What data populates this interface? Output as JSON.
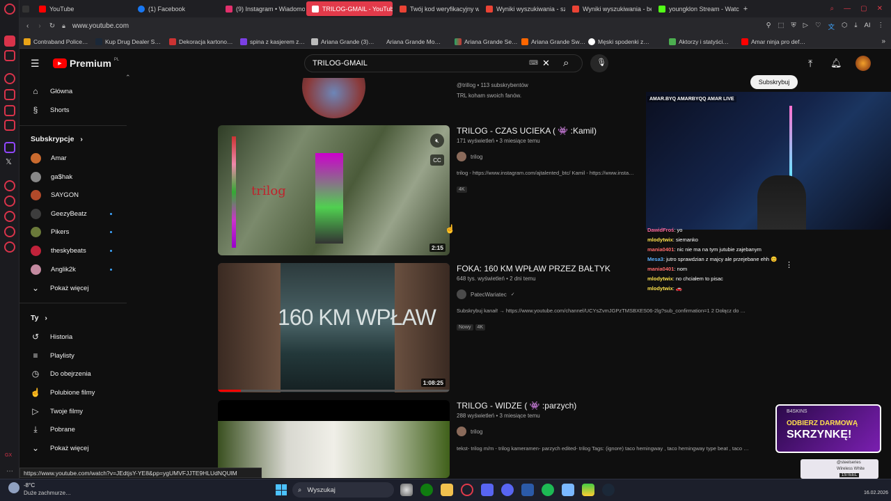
{
  "browser": {
    "tabs": [
      {
        "label": "YouTube",
        "color": "#ff0000"
      },
      {
        "label": "(1) Facebook",
        "color": "#1877f2"
      },
      {
        "label": "(9) Instagram • Wiadomo…",
        "color": "#e1306c"
      },
      {
        "label": "TRILOG-GMAIL - YouTube",
        "color": "#ff0000"
      },
      {
        "label": "Twój kod weryfikacyjny w…",
        "color": "#ea4335"
      },
      {
        "label": "Wyniki wyszukiwania - sz…",
        "color": "#ea4335"
      },
      {
        "label": "Wyniki wyszukiwania - be…",
        "color": "#ea4335"
      },
      {
        "label": "youngklon Stream - Watch…",
        "color": "#53fc18"
      }
    ],
    "url": "www.youtube.com",
    "bookmarks": [
      "Contraband Police…",
      "Kup Drug Dealer S…",
      "Dekoracja kartono…",
      "spina z kasjerem z…",
      "Ariana Grande (3)…",
      "Ariana Grande Mo…",
      "Ariana Grande Se…",
      "Ariana Grande Sw…",
      "Męski spodenki z…",
      "Aktorzy i statyści…",
      "Amar ninja pro def…"
    ],
    "status_url": "https://www.youtube.com/watch?v=JEdtjsY-YE8&pp=ygUMVFJJTE9HLUdNQUlM",
    "ai_label": "AI"
  },
  "youtube": {
    "logo": "Premium",
    "logo_region": "PL",
    "search_value": "TRILOG-GMAIL",
    "sidebar": {
      "main": [
        {
          "label": "Główna",
          "icon": "home-icon",
          "glyph": "⌂"
        },
        {
          "label": "Shorts",
          "icon": "shorts-icon",
          "glyph": "§"
        }
      ],
      "subscriptions_title": "Subskrypcje",
      "subscriptions": [
        {
          "label": "Amar",
          "color": "#c96a2e",
          "dot": false
        },
        {
          "label": "ga$hak",
          "color": "#888888",
          "dot": false
        },
        {
          "label": "SAYGON",
          "color": "#b24a2a",
          "dot": false
        },
        {
          "label": "GeezyBeatz",
          "color": "#3d3d3d",
          "dot": true
        },
        {
          "label": "Pikers",
          "color": "#6b7a3a",
          "dot": true
        },
        {
          "label": "theskybeats",
          "color": "#c0223a",
          "dot": true
        },
        {
          "label": "Anglik2k",
          "color": "#c48aa0",
          "dot": true
        }
      ],
      "show_more": "Pokaż więcej",
      "you_title": "Ty",
      "you": [
        {
          "label": "Historia",
          "icon": "history-icon",
          "glyph": "↺"
        },
        {
          "label": "Playlisty",
          "icon": "playlist-icon",
          "glyph": "≡"
        },
        {
          "label": "Do obejrzenia",
          "icon": "watch-later-icon",
          "glyph": "◷"
        },
        {
          "label": "Polubione filmy",
          "icon": "like-icon",
          "glyph": "👍"
        },
        {
          "label": "Twoje filmy",
          "icon": "your-videos-icon",
          "glyph": "▷"
        },
        {
          "label": "Pobrane",
          "icon": "download-icon",
          "glyph": "⤓"
        }
      ],
      "show_more_2": "Pokaż więcej"
    },
    "channel_result": {
      "handle": "@trillog • 113 subskrybentów",
      "description": "TRL koham swoich fanów."
    },
    "results": [
      {
        "title": "TRILOG - CZAS UCIEKA ( 👾 :Kamil)",
        "meta": "171 wyświetleń • 3 miesiące temu",
        "channel": "trilog",
        "description": "trilog - https://www.instagram.com/ajtalented_btc/ Kamil - https://www.insta…",
        "badges": [
          "4K"
        ],
        "duration": "2:15",
        "thumb_text": "trilog"
      },
      {
        "title": "FOKA: 160 KM WPŁAW PRZEZ BAŁTYK",
        "meta": "648 tys. wyświetleń • 2 dni temu",
        "channel": "PatecWariatec",
        "verified": "✓",
        "description": "Subskrybuj kanał! → https://www.youtube.com/channel/UCYsZvmJGPzTMSBXES06-2lg?sub_confirmation=1 2 Dołącz do …",
        "badges": [
          "Nowy",
          "4K"
        ],
        "duration": "1:08:25",
        "thumb_text": "160 KM WPŁAW"
      },
      {
        "title": "TRILOG - WIDZE ( 👾 :parzych)",
        "meta": "288 wyświetleń • 3 miesiące temu",
        "channel": "trilog",
        "description": "tekst- trilog m/m - trilog kameramen- parzych edited- trilog Tags: (ignore) taco hemingway , taco hemingway type beat , taco …",
        "badges": []
      }
    ]
  },
  "stream": {
    "socials": "AMAR.BYQ  AMARBYQQ  AMAR LIVE",
    "subscribe": "Subskrybuj",
    "chat": [
      {
        "user": "DawidFroś",
        "msg": ": yo"
      },
      {
        "user": "mlodytwix",
        "msg": ": siemanko"
      },
      {
        "user": "mania0401",
        "msg": ": nic nie ma na tym jutubie zajebanym"
      },
      {
        "user": "Mesa3",
        "msg": ": jutro sprawdzian z majcy ale przejebane ehh 😊"
      },
      {
        "user": "mania0401",
        "msg": ": nom"
      },
      {
        "user": "mlodytwix",
        "msg": ": no chciałem to pisac"
      },
      {
        "user": "mlodytwix",
        "msg": ": 🚗"
      }
    ],
    "promo_line1": "ODBIERZ DARMOWĄ",
    "promo_line2": "SKRZYNKĘ!",
    "promo_brand": "B4SKINS",
    "ad_brand": "@steelseries",
    "ad_text": "Wireless White",
    "ad_tag": "1STEEL"
  },
  "taskbar": {
    "weather_temp": "-8°C",
    "weather_desc": "Duże zachmurze…",
    "search_label": "Wyszukaj",
    "date": "16.02.2026",
    "icons": [
      "windows-start-icon",
      "chrome-icon",
      "xbox-icon",
      "file-explorer-icon",
      "opera-gx-icon",
      "discord-icon",
      "discord-icon",
      "opera-icon",
      "spotify-icon",
      "notepad-icon",
      "vpn-icon",
      "steam-icon"
    ]
  }
}
